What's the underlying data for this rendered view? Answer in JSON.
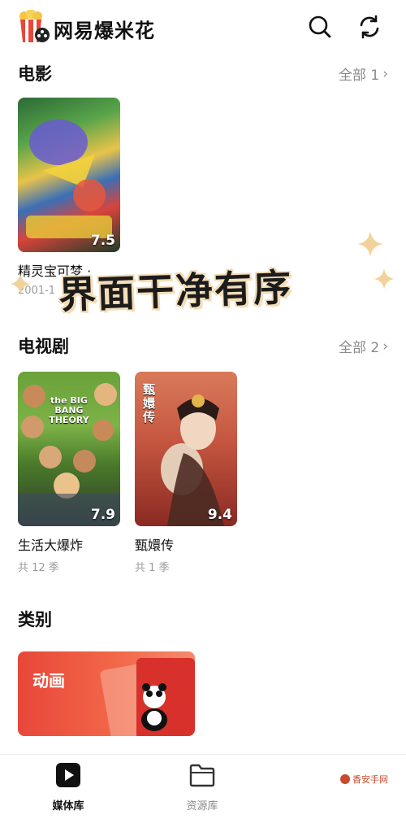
{
  "header": {
    "app_title": "网易爆米花"
  },
  "sections": {
    "movies": {
      "title": "电影",
      "see_all": "全部 1",
      "items": [
        {
          "title": "精灵宝可梦 ·",
          "subtitle": "2001-1",
          "rating": "7.5"
        }
      ]
    },
    "tv": {
      "title": "电视剧",
      "see_all": "全部 2",
      "items": [
        {
          "title": "生活大爆炸",
          "subtitle": "共 12 季",
          "rating": "7.9",
          "poster_text": "the BIG BANG THEORY"
        },
        {
          "title": "甄嬛传",
          "subtitle": "共 1 季",
          "rating": "9.4",
          "poster_text": "甄嬛传"
        }
      ]
    },
    "categories": {
      "title": "类别",
      "items": [
        {
          "label": "动画"
        }
      ]
    }
  },
  "overlay": {
    "text": "界面干净有序"
  },
  "tabbar": {
    "items": [
      {
        "label": "媒体库",
        "icon": "play-icon",
        "active": true
      },
      {
        "label": "资源库",
        "icon": "folder-icon",
        "active": false
      }
    ],
    "watermark": "香安手网"
  },
  "colors": {
    "accent": "#111111",
    "muted": "#8a8a8a",
    "category_red": "#e8473a"
  }
}
